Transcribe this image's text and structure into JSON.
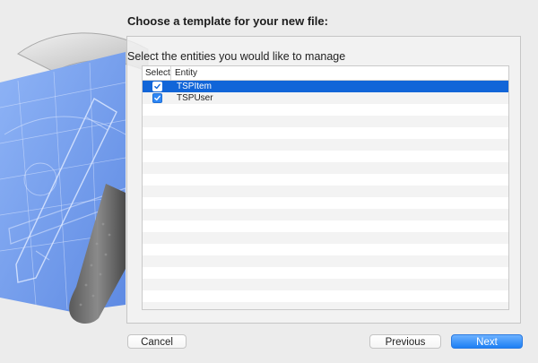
{
  "dialog": {
    "title": "Choose a template for your new file:",
    "instruction": "Select the entities you would like to manage"
  },
  "table": {
    "columns": [
      "Select",
      "Entity"
    ],
    "rows": [
      {
        "checked": true,
        "entity": "TSPItem",
        "selected": true
      },
      {
        "checked": true,
        "entity": "TSPUser",
        "selected": false
      }
    ]
  },
  "buttons": {
    "cancel": "Cancel",
    "previous": "Previous",
    "next": "Next"
  },
  "colors": {
    "selection": "#1165d8",
    "primary_button": "#1d7ff4",
    "blueprint": "#7ea6f0"
  },
  "icons": {
    "background": "xcode-blueprint-hammer-artwork",
    "checkbox": "checkmark-icon"
  }
}
